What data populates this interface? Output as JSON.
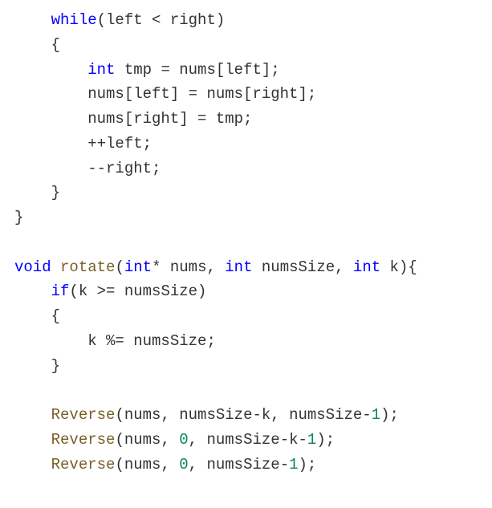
{
  "code": {
    "l1_indent": "    ",
    "l1_kw": "while",
    "l1_rest": "(left < right)",
    "l2_indent": "    ",
    "l2_brace": "{",
    "l3_indent": "        ",
    "l3_kw": "int",
    "l3_rest": " tmp = nums[left];",
    "l4_indent": "        ",
    "l4_text": "nums[left] = nums[right];",
    "l5_indent": "        ",
    "l5_text": "nums[right] = tmp;",
    "l6_indent": "        ",
    "l6_text": "++left;",
    "l7_indent": "        ",
    "l7_text": "--right;",
    "l8_indent": "    ",
    "l8_brace": "}",
    "l9_brace": "}",
    "l10_blank": "",
    "l11_kw1": "void",
    "l11_func": " rotate",
    "l11_p1": "(",
    "l11_kw2": "int",
    "l11_p2": "* nums, ",
    "l11_kw3": "int",
    "l11_p3": " numsSize, ",
    "l11_kw4": "int",
    "l11_p4": " k){",
    "l12_indent": "    ",
    "l12_kw": "if",
    "l12_rest": "(k >= numsSize)",
    "l13_indent": "    ",
    "l13_brace": "{",
    "l14_indent": "        ",
    "l14_text": "k %= numsSize;",
    "l15_indent": "    ",
    "l15_brace": "}",
    "l16_blank": "",
    "l17_indent": "    ",
    "l17_func": "Reverse",
    "l17_p1": "(nums, numsSize-k, numsSize-",
    "l17_n1": "1",
    "l17_p2": ");",
    "l18_indent": "    ",
    "l18_func": "Reverse",
    "l18_p1": "(nums, ",
    "l18_n1": "0",
    "l18_p2": ", numsSize-k-",
    "l18_n2": "1",
    "l18_p3": ");",
    "l19_indent": "    ",
    "l19_func": "Reverse",
    "l19_p1": "(nums, ",
    "l19_n1": "0",
    "l19_p2": ", numsSize-",
    "l19_n2": "1",
    "l19_p3": ");"
  }
}
